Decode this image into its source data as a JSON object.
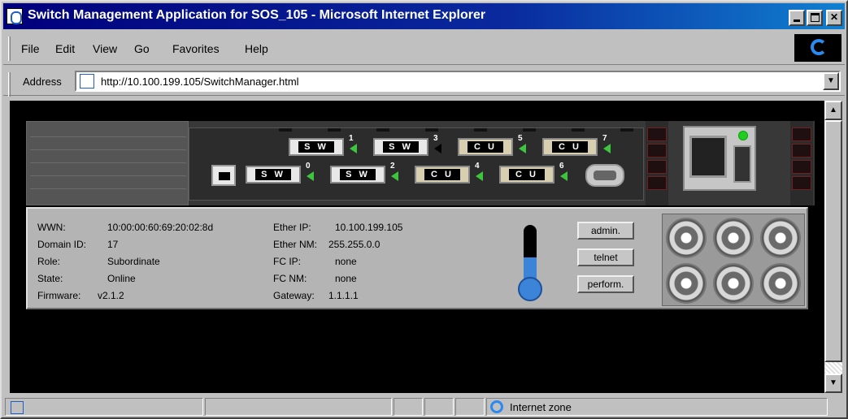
{
  "window": {
    "title": "Switch Management Application for SOS_105 - Microsoft Internet Explorer"
  },
  "menu": {
    "items": [
      {
        "label": "File"
      },
      {
        "label": "Edit"
      },
      {
        "label": "View"
      },
      {
        "label": "Go"
      },
      {
        "label": "Favorites"
      },
      {
        "label": "Help"
      }
    ]
  },
  "address": {
    "label": "Address",
    "url": "http://10.100.199.105/SwitchManager.html"
  },
  "switch": {
    "top_ports": [
      {
        "type": "S W",
        "num": "1"
      },
      {
        "type": "S W",
        "num": "3"
      },
      {
        "type": "C U",
        "num": "5"
      },
      {
        "type": "C U",
        "num": "7"
      }
    ],
    "bottom_ports": [
      {
        "type": "S W",
        "num": "0"
      },
      {
        "type": "S W",
        "num": "2"
      },
      {
        "type": "C U",
        "num": "4"
      },
      {
        "type": "C U",
        "num": "6"
      }
    ],
    "info_left": [
      {
        "label": "WWN:",
        "value": "10:00:00:60:69:20:02:8d"
      },
      {
        "label": "Domain ID:",
        "value": "17"
      },
      {
        "label": "Role:",
        "value": "Subordinate"
      },
      {
        "label": "State:",
        "value": "Online"
      },
      {
        "label": "Firmware:",
        "value": "v2.1.2"
      }
    ],
    "info_right": [
      {
        "label": "Ether IP:",
        "value": "10.100.199.105"
      },
      {
        "label": "Ether NM:",
        "value": "255.255.0.0"
      },
      {
        "label": "FC IP:",
        "value": "none"
      },
      {
        "label": "FC NM:",
        "value": "none"
      },
      {
        "label": "Gateway:",
        "value": "1.1.1.1"
      }
    ],
    "buttons": {
      "admin": "admin.",
      "telnet": "telnet",
      "perform": "perform."
    },
    "temperature_level": 0.5
  },
  "status": {
    "zone": "Internet zone"
  },
  "colors": {
    "titlebar": "#00007b",
    "port_led": "#3ec53e",
    "power_led": "#22cc22",
    "thermo": "#3b84d8"
  }
}
